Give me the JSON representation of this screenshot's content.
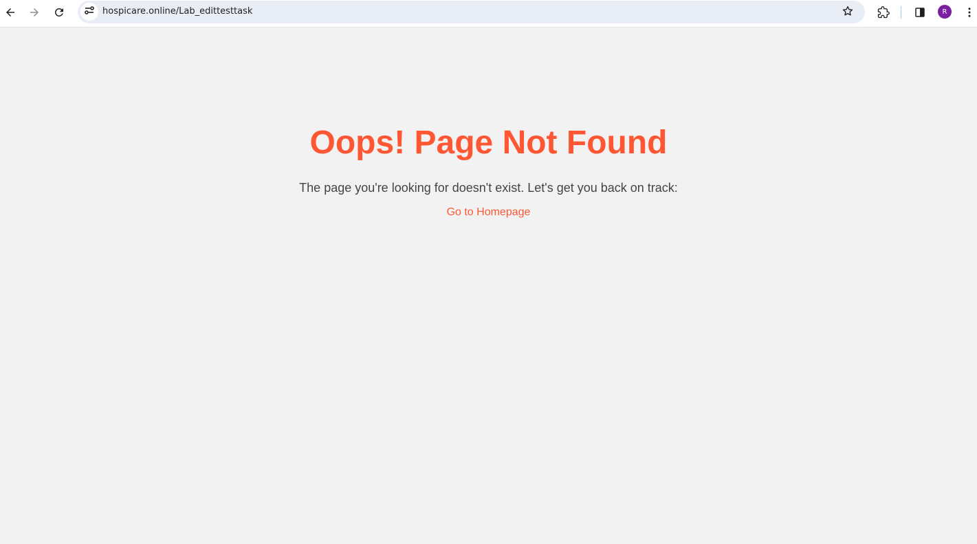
{
  "browser": {
    "url": "hospicare.online/Lab_edittesttask",
    "profile_initial": "R",
    "colors": {
      "omnibox_bg": "#e9edf6",
      "avatar_bg": "#7b1fa2"
    },
    "icons": [
      "back-arrow-icon",
      "forward-arrow-icon",
      "reload-icon",
      "site-info-icon",
      "star-icon",
      "extensions-icon",
      "side-panel-icon",
      "more-menu-icon"
    ]
  },
  "page": {
    "title": "Oops! Page Not Found",
    "message": "The page you're looking for doesn't exist. Let's get you back on track:",
    "home_link": "Go to Homepage",
    "colors": {
      "accent": "#ff5733",
      "text": "#444444",
      "background": "#f2f2f2"
    }
  }
}
